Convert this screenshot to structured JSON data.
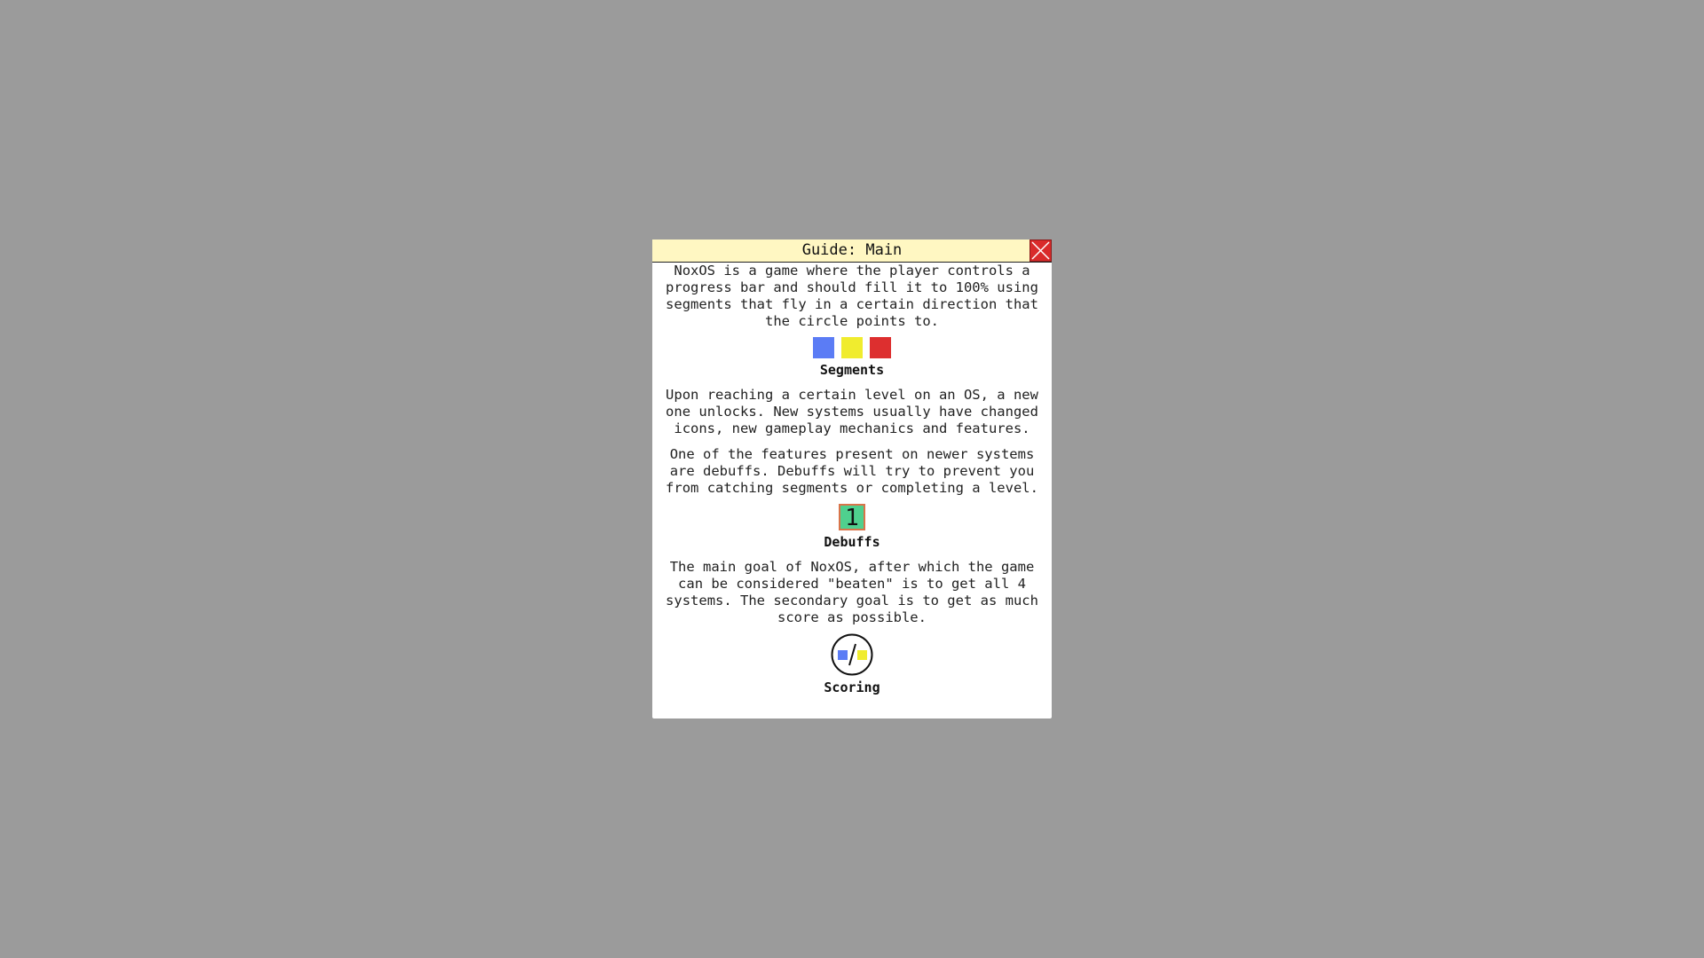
{
  "window": {
    "title": "Guide: Main",
    "close_icon": "close-icon"
  },
  "paragraphs": {
    "intro": "NoxOS is a game where the player controls a progress bar and should fill it to 100% using segments that fly in a certain direction that the circle points to.",
    "levels": "Upon reaching a certain level on an OS, a new one unlocks. New systems usually have changed icons, new gameplay mechanics and features.",
    "debuffs": "One of the features present on newer systems are debuffs. Debuffs will try to prevent you from catching segments or completing a level.",
    "goal": "The main goal of NoxOS, after which the game can be considered \"beaten\" is to get all 4 systems. The secondary goal is to get as much score as possible."
  },
  "segments": {
    "caption": "Segments",
    "colors": [
      "#5b7cf5",
      "#f0ec2e",
      "#dd2f2f"
    ]
  },
  "debuffs": {
    "caption": "Debuffs",
    "icon_text": "1",
    "fill_color": "#4fd08e",
    "border_color": "#d9744a"
  },
  "scoring": {
    "caption": "Scoring",
    "icon": "scoring-icon"
  }
}
